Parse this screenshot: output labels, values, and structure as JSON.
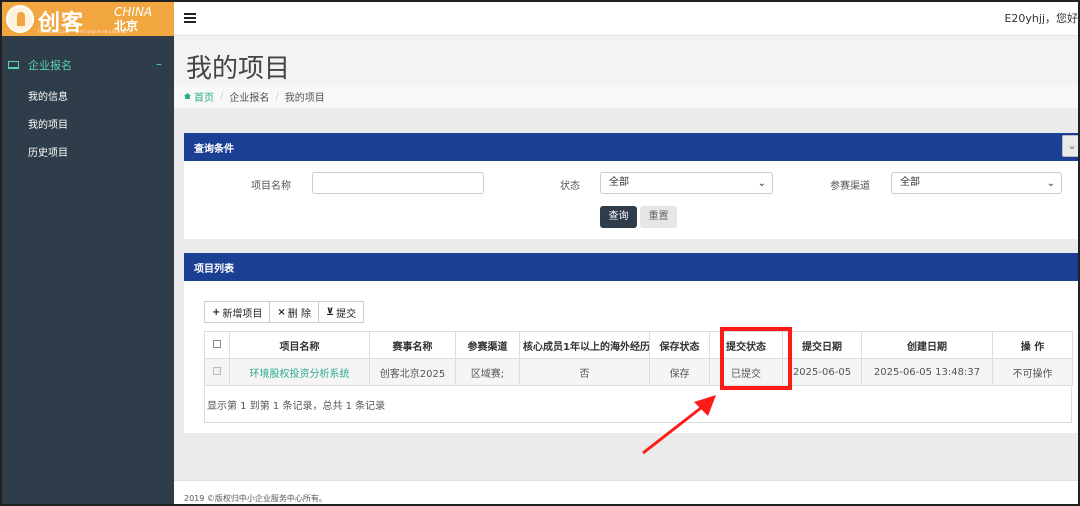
{
  "sidebar": {
    "logo": {
      "brand": "创客",
      "en": "CHINA",
      "city": "北京",
      "tagline": "Innovation · Entrepreneurship"
    },
    "group_label": "企业报名",
    "items": [
      {
        "label": "我的信息"
      },
      {
        "label": "我的项目"
      },
      {
        "label": "历史项目"
      }
    ]
  },
  "topbar": {
    "greeting": "E20yhjj，您好"
  },
  "page": {
    "title": "我的项目",
    "breadcrumb": [
      "首页",
      "企业报名",
      "我的项目"
    ]
  },
  "query": {
    "title": "查询条件",
    "name_label": "项目名称",
    "name_value": "",
    "status_label": "状态",
    "status_value": "全部",
    "channel_label": "参赛渠道",
    "channel_value": "全部",
    "search_label": "查询",
    "reset_label": "重置"
  },
  "list": {
    "title": "项目列表",
    "toolbar": {
      "add": "新增项目",
      "delete": "删 除",
      "submit": "提交"
    },
    "headers": [
      "项目名称",
      "赛事名称",
      "参赛渠道",
      "核心成员1年以上的海外经历",
      "保存状态",
      "提交状态",
      "提交日期",
      "创建日期",
      "操 作"
    ],
    "rows": [
      {
        "name": "环境股权投资分析系统",
        "event": "创客北京2025",
        "channel": "区域赛;",
        "overseas": "否",
        "save": "保存",
        "submit": "已提交",
        "submit_date": "2025-06-05",
        "created": "2025-06-05 13:48:37",
        "op": "不可操作"
      }
    ],
    "summary": "显示第 1 到第 1 条记录，总共 1 条记录"
  },
  "footer": {
    "text": "2019 ©版权归中小企业服务中心所有。"
  },
  "colors": {
    "sidebar": "#2f3d4a",
    "panel_header": "#1b3f93",
    "accent": "#2bab8a",
    "logo": "#f2a640",
    "annotation": "#ff1a1a"
  }
}
